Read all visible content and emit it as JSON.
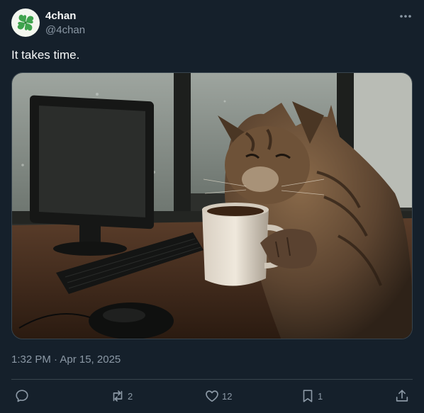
{
  "author": {
    "name": "4chan",
    "handle": "@4chan",
    "avatar_icon": "four-leaf-clover-icon"
  },
  "tweet": {
    "text": "It takes time.",
    "media_subject": "cat-with-coffee-mug-at-computer-desk-photo",
    "timestamp": "1:32 PM · Apr 15, 2025"
  },
  "actions": {
    "reply": {
      "icon": "reply-icon",
      "count": ""
    },
    "repost": {
      "icon": "repost-icon",
      "count": "2"
    },
    "like": {
      "icon": "heart-icon",
      "count": "12"
    },
    "bookmark": {
      "icon": "bookmark-icon",
      "count": "1"
    },
    "share": {
      "icon": "share-icon",
      "count": ""
    }
  },
  "colors": {
    "background": "#15202b",
    "text_primary": "#f7f9f9",
    "text_secondary": "#8b98a5",
    "border": "#38444d",
    "clover_green": "#3fa34d"
  }
}
